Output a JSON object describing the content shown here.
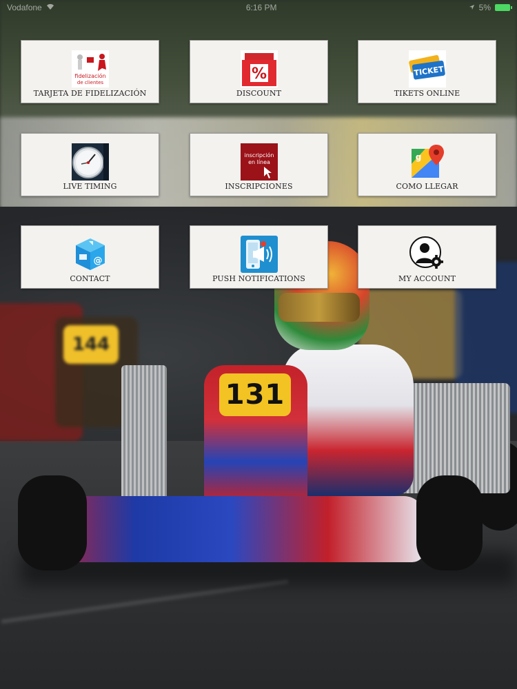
{
  "status_bar": {
    "carrier": "Vodafone",
    "time": "6:16 PM",
    "battery": "5%"
  },
  "menu": {
    "tiles": [
      {
        "label": "TARJETA DE FIDELIZACIÓN",
        "icon": "loyalty-card-icon",
        "icon_text_1": "fidelización",
        "icon_text_2": "de clientes"
      },
      {
        "label": "DISCOUNT",
        "icon": "percent-tag-icon"
      },
      {
        "label": "TIKETS ONLINE",
        "icon": "ticket-icon",
        "icon_text_1": "TICKET"
      },
      {
        "label": "LIVE TIMING",
        "icon": "stopwatch-icon"
      },
      {
        "label": "INSCRIPCIONES",
        "icon": "registration-icon",
        "icon_text_1": "inscripción",
        "icon_text_2": "en línea"
      },
      {
        "label": "COMO LLEGAR",
        "icon": "maps-pin-icon"
      },
      {
        "label": "CONTACT",
        "icon": "contact-cube-icon"
      },
      {
        "label": "PUSH NOTIFICATIONS",
        "icon": "megaphone-icon"
      },
      {
        "label": "MY ACCOUNT",
        "icon": "account-gear-icon"
      }
    ]
  },
  "background": {
    "kart_number": "131",
    "blurred_kart_number": "144"
  },
  "colors": {
    "tile_bg": "#f3f2ef",
    "tile_border": "#9a9a9a",
    "battery": "#4cd964"
  }
}
